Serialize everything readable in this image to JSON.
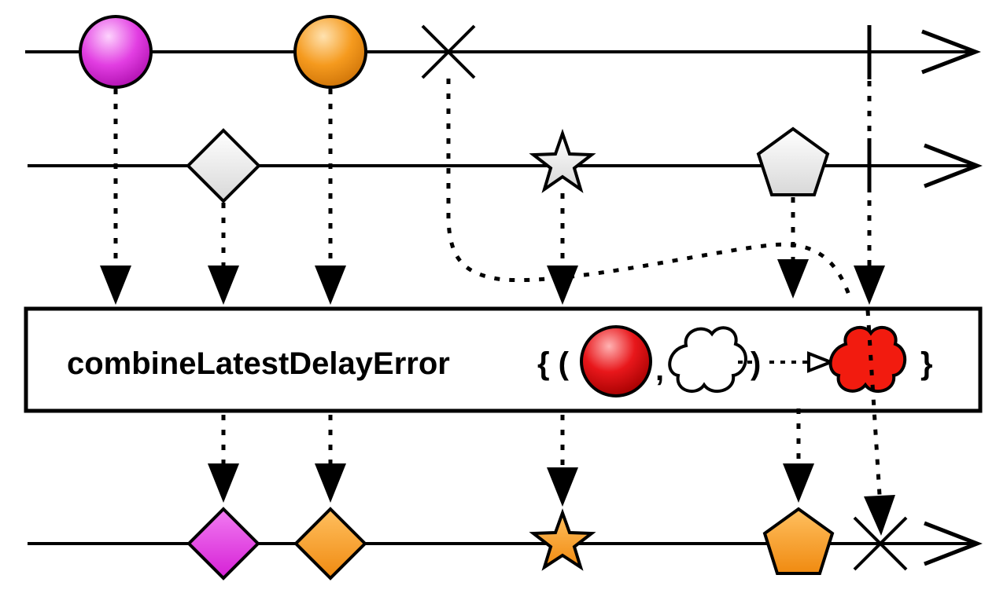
{
  "diagram": {
    "operator": {
      "name": "combineLatestDelayError",
      "open_brace": "{ (",
      "comma": ",",
      "close_paren": ")",
      "close_brace": "}"
    },
    "colors": {
      "magenta": "#e23ee2",
      "orange": "#f59a1e",
      "red": "#e8171b",
      "white": "#ffffff",
      "line": "#000000"
    },
    "input_streams": [
      {
        "name": "source-a",
        "items": [
          {
            "shape": "circle",
            "color": "magenta"
          },
          {
            "shape": "circle",
            "color": "orange"
          },
          {
            "shape": "error-x"
          },
          {
            "shape": "completion-bar"
          }
        ]
      },
      {
        "name": "source-b",
        "items": [
          {
            "shape": "diamond",
            "color": "white"
          },
          {
            "shape": "star",
            "color": "white"
          },
          {
            "shape": "pentagon",
            "color": "white"
          },
          {
            "shape": "completion-bar"
          }
        ]
      }
    ],
    "output_stream": {
      "name": "result",
      "items": [
        {
          "shape": "diamond",
          "color": "magenta"
        },
        {
          "shape": "diamond",
          "color": "orange"
        },
        {
          "shape": "star",
          "color": "orange"
        },
        {
          "shape": "pentagon",
          "color": "orange"
        },
        {
          "shape": "error-x"
        }
      ]
    }
  }
}
